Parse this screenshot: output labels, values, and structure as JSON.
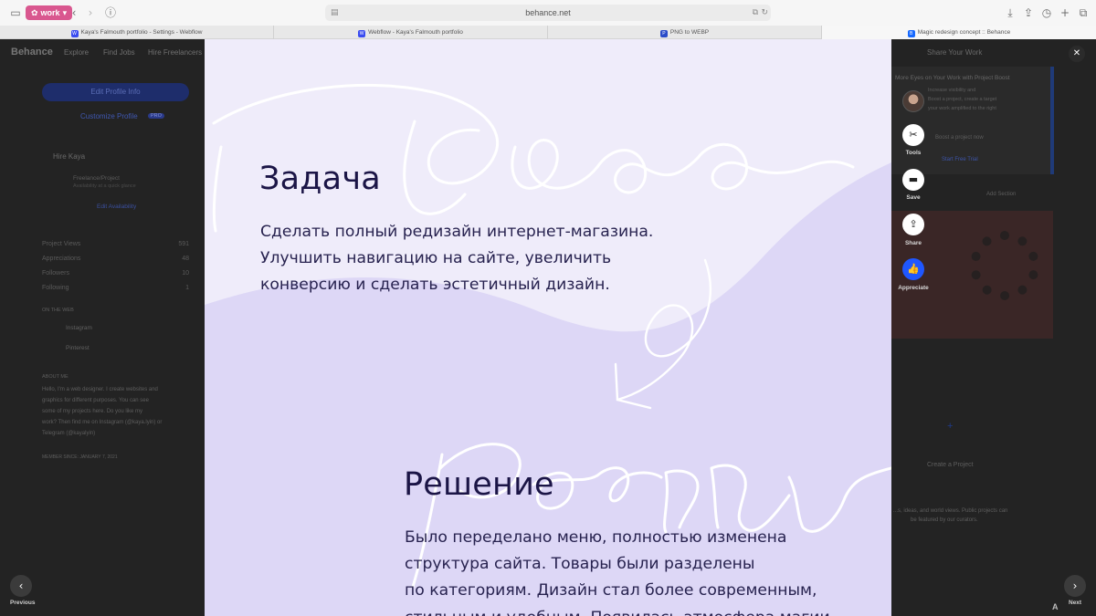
{
  "browser": {
    "profile_label": "work",
    "url": "behance.net",
    "tabs": [
      {
        "title": "Kaya's Falmouth portfolio - Settings - Webflow",
        "favicon": "W"
      },
      {
        "title": "Webflow - Kaya's Falmouth portfolio",
        "favicon": "W"
      },
      {
        "title": "PNG to WEBP",
        "favicon": "P"
      },
      {
        "title": "Magic redesign concept :: Behance",
        "favicon": "Bē"
      }
    ]
  },
  "background": {
    "logo": "Behance",
    "nav": [
      "Explore",
      "Find Jobs",
      "Hire Freelancers"
    ],
    "share_work": "Share Your Work",
    "edit_profile": "Edit Profile Info",
    "customize_profile": "Customize Profile",
    "pro_badge": "PRO",
    "hire_title": "Hire Kaya",
    "hire_option": "Freelance/Project",
    "hire_option_sub": "Availability at a quick glance",
    "edit_availability": "Edit Availability",
    "stats": [
      {
        "label": "Project Views",
        "value": "591"
      },
      {
        "label": "Appreciations",
        "value": "48"
      },
      {
        "label": "Followers",
        "value": "10"
      },
      {
        "label": "Following",
        "value": "1"
      }
    ],
    "on_the_web": "ON THE WEB",
    "socials": [
      "Instagram",
      "Pinterest"
    ],
    "about_title": "ABOUT ME",
    "about_lines": [
      "Hello, I'm a web designer. I create websites and",
      "graphics for different purposes. You can see",
      "some of my projects here. Do you like my",
      "work? Then find me on Instagram (@kaya.lyin) or",
      "Telegram (@kayalyin)"
    ],
    "member_since": "MEMBER SINCE: JANUARY 7, 2021",
    "boost_title": "More Eyes on Your Work with Project Boost",
    "boost_line1": "Increase visibility and",
    "boost_line2": "Boost a project, create a target",
    "boost_line3": "your work amplified to the right",
    "boost_cta": "Boost a project now",
    "start_trial": "Start Free Trial",
    "add_section": "Add Section",
    "create_project": "Create a Project",
    "public_note_1": "...s, ideas, and world views. Public projects can",
    "public_note_2": "be featured by our curators."
  },
  "lightbox": {
    "task_heading": "Задача",
    "task_lines": [
      "Сделать полный редизайн интернет-магазина.",
      "Улучшить навигацию на сайте, увеличить",
      "конверсию и сделать эстетичный дизайн."
    ],
    "solution_heading": "Решение",
    "solution_lines": [
      "Было переделано меню, полностью изменена",
      "структура сайта. Товары были разделены",
      "по категориям. Дизайн стал более современным,",
      "стильным и удобным. Появилась атмосфера магии"
    ],
    "colors": {
      "background": "#efecfa",
      "wave": "#ddd7f6",
      "text": "#1b1546"
    }
  },
  "actions": {
    "tools": "Tools",
    "save": "Save",
    "share": "Share",
    "appreciate": "Appreciate"
  },
  "navigation": {
    "previous": "Previous",
    "next": "Next",
    "close_icon": "close-icon"
  }
}
